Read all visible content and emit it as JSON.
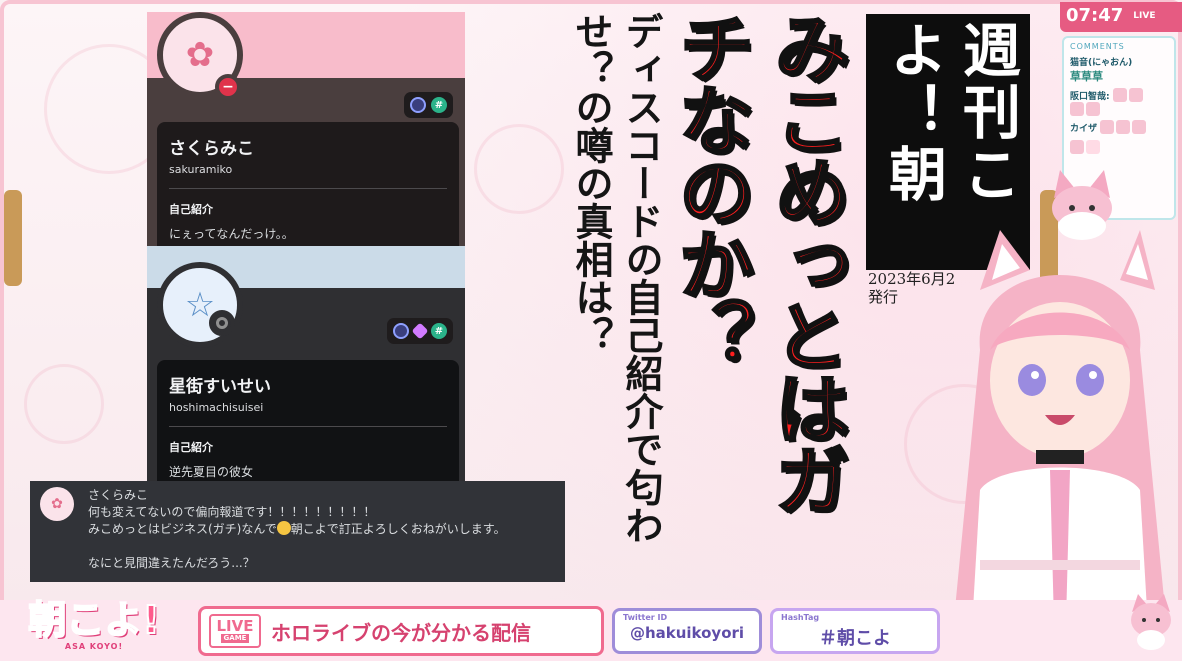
{
  "clock": {
    "time": "07:47",
    "live": "LIVE"
  },
  "comments": {
    "header": "COMMENTS",
    "entries": [
      {
        "user": "猫音(にゃおん)",
        "text": "草草草"
      },
      {
        "user": "阪口智哉:",
        "text": ""
      },
      {
        "user": "カイザ",
        "text": ""
      }
    ]
  },
  "card1": {
    "display_name": "さくらみこ",
    "username": "sakuramiko",
    "section_label": "自己紹介",
    "section_text": "にぇってなんだっけ。。",
    "status": "dnd"
  },
  "card2": {
    "display_name": "星街すいせい",
    "username": "hoshimachisuisei",
    "section_label": "自己紹介",
    "section_text": "逆先夏目の彼女",
    "status": "offline"
  },
  "chat": {
    "author": "さくらみこ",
    "lines": [
      "何も変えてないので偏向報道です！！！！！！！！！",
      "みこめっとはビジネス(ガチ)なんで",
      "朝こよで訂正よろしくおねがいします。",
      "なにと見間違えたんだろう...？"
    ]
  },
  "headline_red": "みこめっとはガチなのか？",
  "headline_black": "ディスコードの自己紹介で匂わせ？の噂の真相は？",
  "magazine": {
    "title": "週刊こよ！朝",
    "issue_date": "2023年6月2",
    "issue_label": "発行"
  },
  "bottom": {
    "logo": "朝こよ!",
    "logo_sub": "ASA KOYO!",
    "live_badge": "LIVE",
    "live_badge_sub": "GAME",
    "live_text": "ホロライブの今が分かる配信",
    "twitter_label": "Twitter ID",
    "twitter_id": "@hakuikoyori",
    "hashtag_label": "HashTag",
    "hashtag": "＃朝こよ"
  },
  "colors": {
    "accent_pink": "#f06a8f",
    "headline_red": "#ff1e1e",
    "discord_bg": "#313338"
  }
}
